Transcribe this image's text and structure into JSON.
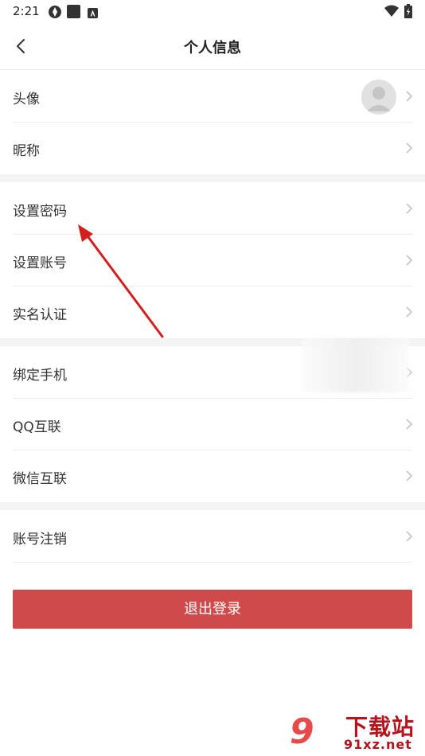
{
  "status_bar": {
    "time": "2:21"
  },
  "header": {
    "title": "个人信息"
  },
  "groups": [
    {
      "items": [
        {
          "label": "头像"
        },
        {
          "label": "昵称"
        }
      ]
    },
    {
      "items": [
        {
          "label": "设置密码"
        },
        {
          "label": "设置账号"
        },
        {
          "label": "实名认证"
        }
      ]
    },
    {
      "items": [
        {
          "label": "绑定手机"
        },
        {
          "label": "QQ互联"
        },
        {
          "label": "微信互联"
        }
      ]
    },
    {
      "items": [
        {
          "label": "账号注销"
        }
      ]
    }
  ],
  "logout": {
    "label": "退出登录"
  },
  "watermark": {
    "number": "9",
    "site_name": "下载站",
    "url": "91xz.net"
  },
  "colors": {
    "accent": "#cf4a4a",
    "annotation_arrow": "#d41f1f",
    "watermark": "#b5141d"
  },
  "icons": {
    "back": "chevron-left-icon",
    "row_chevron": "chevron-right-icon",
    "avatar": "default-avatar-icon"
  }
}
